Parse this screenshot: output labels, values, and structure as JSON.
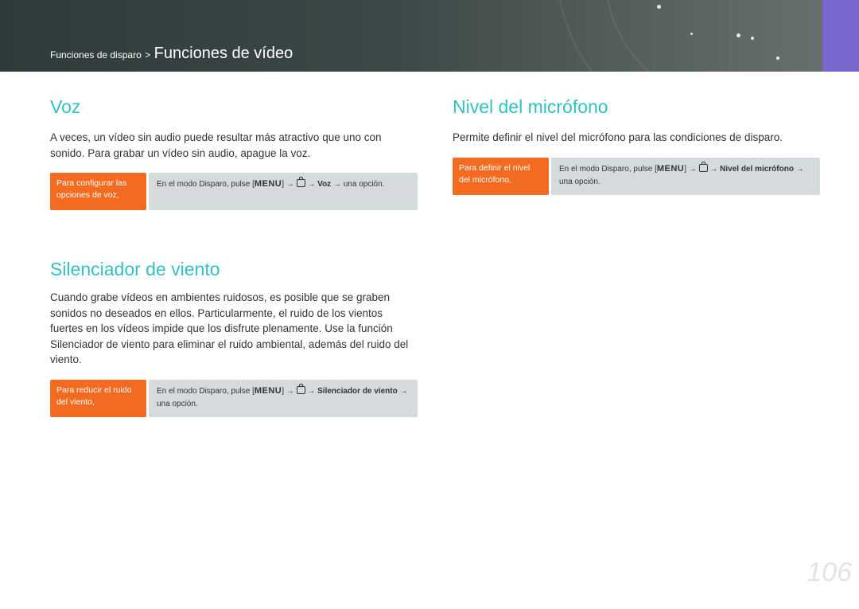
{
  "header": {
    "breadcrumb_parent": "Funciones de disparo",
    "breadcrumb_separator": ">",
    "breadcrumb_current": "Funciones de vídeo"
  },
  "voz": {
    "title": "Voz",
    "text": "A veces, un vídeo sin audio puede resultar más atractivo que uno con sonido. Para grabar un vídeo sin audio, apague la voz.",
    "tip_label": "Para configurar las opciones de voz,",
    "tip_prefix": "En el modo Disparo, pulse [",
    "tip_menu": "MENU",
    "tip_mid": "] → ",
    "tip_arrow": " → ",
    "tip_bold": "Voz",
    "tip_suffix": " → una opción."
  },
  "silenciador": {
    "title": "Silenciador de viento",
    "text": "Cuando grabe vídeos en ambientes ruidosos, es posible que se graben sonidos no deseados en ellos. Particularmente, el ruido de los vientos fuertes en los vídeos impide que los disfrute plenamente. Use la función Silenciador de viento para eliminar el ruido ambiental, además del ruido del viento.",
    "tip_label": "Para reducir el ruido del viento,",
    "tip_prefix": "En el modo Disparo, pulse [",
    "tip_menu": "MENU",
    "tip_mid": "] → ",
    "tip_arrow": " → ",
    "tip_bold": "Silenciador de viento",
    "tip_suffix": " → una opción."
  },
  "nivel": {
    "title": "Nivel del micrófono",
    "text": "Permite definir el nivel del micrófono para las condiciones de disparo.",
    "tip_label": "Para definir el nivel del micrófono,",
    "tip_prefix": "En el modo Disparo, pulse [",
    "tip_menu": "MENU",
    "tip_mid": "] → ",
    "tip_arrow": " → ",
    "tip_bold": "Nivel del micrófono",
    "tip_suffix": " → una opción."
  },
  "page_number": "106",
  "colors": {
    "heading": "#32c0c0",
    "tip_label_bg": "#f36b21",
    "tip_body_bg": "#d5dbdd",
    "side_tab": "#7a66cf"
  },
  "icons": {
    "menu": "menu-button-icon",
    "video": "video-camera-icon"
  }
}
